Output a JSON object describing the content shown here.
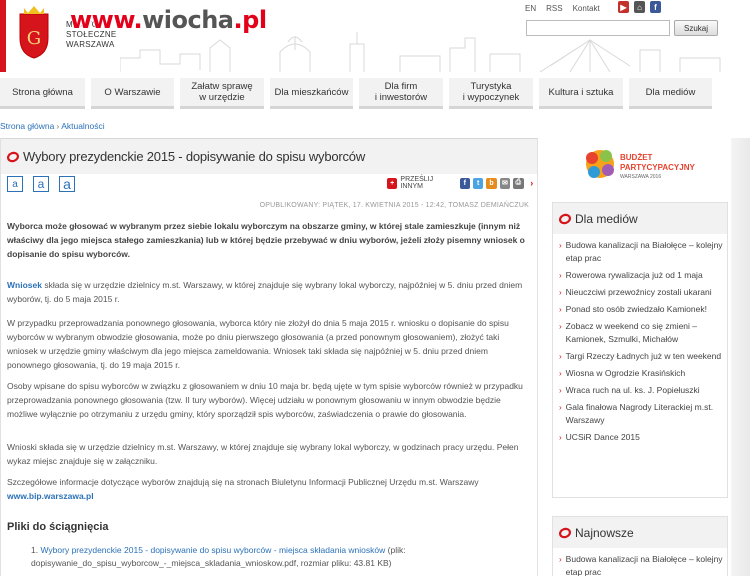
{
  "header": {
    "logo_lines": [
      "MIASTO",
      "STOŁECZNE",
      "WARSZAWA"
    ],
    "watermark": [
      "www.",
      "wiocha",
      ".pl"
    ],
    "top_links": [
      "EN",
      "RSS",
      "Kontakt"
    ],
    "search_button": "Szukaj",
    "search_value": ""
  },
  "nav": [
    {
      "label": "Strona główna",
      "w": 85
    },
    {
      "label": "O Warszawie",
      "w": 83
    },
    {
      "label": "Załatw sprawę\nw urzędzie",
      "w": 84
    },
    {
      "label": "Dla mieszkańców",
      "w": 83
    },
    {
      "label": "Dla firm\ni inwestorów",
      "w": 84
    },
    {
      "label": "Turystyka\ni wypoczynek",
      "w": 84
    },
    {
      "label": "Kultura i sztuka",
      "w": 84
    },
    {
      "label": "Dla mediów",
      "w": 83
    }
  ],
  "breadcrumb": [
    "Strona główna",
    "Aktualności"
  ],
  "article": {
    "title": "Wybory prezydenckie 2015 - dopisywanie do spisu wyborców",
    "font_buttons": [
      "a",
      "a",
      "a"
    ],
    "share_label": "PRZEŚLIJ INNYM",
    "meta": "OPUBLIKOWANY: PIĄTEK, 17. KWIETNIA 2015 - 12:42, TOMASZ DEMIAŃCZUK",
    "lead": "Wyborca może głosować w wybranym przez siebie lokalu wyborczym na obszarze gminy, w której stale zamieszkuje (innym niż właściwy dla jego miejsca stałego zamieszkania) lub w której będzie przebywać w dniu wyborów, jeżeli złoży pisemny wniosek o dopisanie do spisu wyborców.",
    "p1_link": "Wniosek",
    "p1_rest": " składa się w urzędzie dzielnicy m.st. Warszawy, w której znajduje się wybrany lokal wyborczy, najpóźniej w 5. dniu przed dniem wyborów, tj. do 5 maja 2015 r.",
    "p2": "W przypadku przeprowadzania ponownego głosowania, wyborca który nie złożył do dnia 5 maja 2015 r. wniosku o dopisanie do spisu wyborców w wybranym obwodzie głosowania, może po dniu pierwszego głosowania (a przed ponownym głosowaniem), złożyć taki wniosek w urzędzie gminy właściwym dla jego miejsca zameldowania. Wniosek taki składa się najpóźniej w 5. dniu przed dniem ponownego głosowania, tj. do 19 maja 2015 r.",
    "p3": "Osoby wpisane do spisu wyborców w związku z głosowaniem w dniu 10 maja br. będą ujęte w tym spisie wyborców również w przypadku przeprowadzania ponownego głosowania (tzw. II tury wyborów). Więcej udziału w ponownym głosowaniu w innym obwodzie będzie możliwe wyłącznie po otrzymaniu z urzędu gminy, który sporządził spis wyborców, zaświadczenia o prawie do głosowania.",
    "p4": "Wnioski składa się w urzędzie dzielnicy m.st. Warszawy, w której znajduje się wybrany lokal wyborczy, w godzinach pracy urzędu. Pełen wykaz miejsc znajduje się w załączniku.",
    "p5": "Szczegółowe informacje dotyczące wyborów znajdują się na stronach Biuletynu Informacji Publicznej Urzędu m.st. Warszawy",
    "p5_link": "www.bip.warszawa.pl",
    "files_heading": "Pliki do ściągnięcia",
    "file_num": "1.",
    "file_link": "Wybory prezydenckie 2015 - dopisywanie do spisu wyborców - miejsca składania wniosków",
    "file_info": " (plik: dopisywanie_do_spisu_wyborcow_-_miejsca_skladania_wnioskow.pdf, rozmiar pliku: 43.81 KB)"
  },
  "sidebar": {
    "budzet_line1": "BUDŻET",
    "budzet_line2": "PARTYCYPACYJNY",
    "budzet_line3": "WARSZAWA 2016",
    "media_title": "Dla mediów",
    "media_items": [
      "Budowa kanalizacji na Białołęce – kolejny etap prac",
      "Rowerowa rywalizacja już od 1 maja",
      "Nieuczciwi przewoźnicy zostali ukarani",
      "Ponad sto osób zwiedzało Kamionek!",
      "Zobacz w weekend co się zmieni – Kamionek, Szmulki, Michałów",
      "Targi Rzeczy Ładnych już w ten weekend",
      "Wiosna w Ogrodzie Krasińskich",
      "Wraca ruch na ul. ks. J. Popiełuszki",
      "Gala finałowa Nagrody Literackiej m.st. Warszawy",
      "UCSiR Dance 2015"
    ],
    "newest_title": "Najnowsze",
    "newest_items": [
      "Budowa kanalizacji na Białołęce – kolejny etap prac"
    ]
  },
  "colors": {
    "accent": "#d6141b",
    "link": "#2b72b8"
  }
}
